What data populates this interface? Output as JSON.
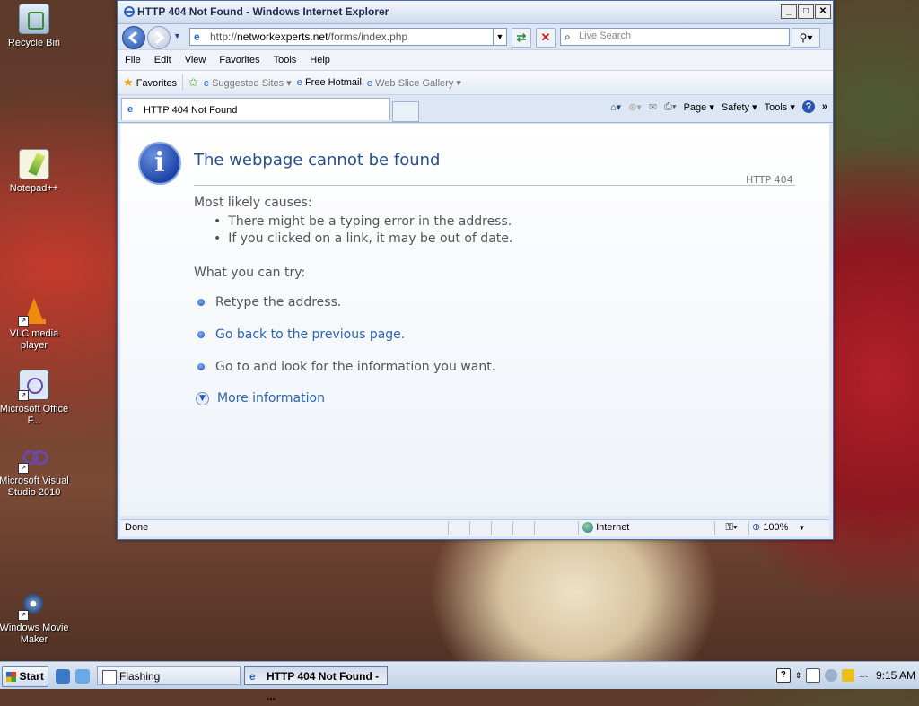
{
  "desktop": {
    "icons": [
      {
        "label": "Recycle Bin",
        "icon": "recycle-bin-icon"
      },
      {
        "label": "Notepad++",
        "icon": "notepadpp-icon"
      },
      {
        "label": "VLC media player",
        "icon": "vlc-icon"
      },
      {
        "label": "Microsoft Office F...",
        "icon": "office-icon"
      },
      {
        "label": "Microsoft Visual Studio 2010",
        "icon": "visual-studio-icon"
      },
      {
        "label": "Windows Movie Maker",
        "icon": "movie-maker-icon"
      }
    ]
  },
  "window": {
    "title": "HTTP 404 Not Found - Windows Internet Explorer",
    "controls": {
      "minimize": "_",
      "maximize": "□",
      "close": "✕"
    }
  },
  "address": {
    "url_prefix": "http://",
    "url_host": "networkexperts.net",
    "url_path": "/forms/index.php",
    "search_placeholder": "Live Search"
  },
  "menu": [
    "File",
    "Edit",
    "View",
    "Favorites",
    "Tools",
    "Help"
  ],
  "favorites_bar": {
    "favorites_label": "Favorites",
    "suggested_sites": "Suggested Sites",
    "free_hotmail": "Free Hotmail",
    "web_slice_gallery": "Web Slice Gallery"
  },
  "tab": {
    "title": "HTTP 404 Not Found"
  },
  "command_bar": {
    "page": "Page",
    "safety": "Safety",
    "tools": "Tools"
  },
  "error_page": {
    "title": "The webpage cannot be found",
    "code": "HTTP 404",
    "causes_heading": "Most likely causes:",
    "causes": [
      "There might be a typing error in the address.",
      "If you clicked on a link, it may be out of date."
    ],
    "try_heading": "What you can try:",
    "try_items": [
      {
        "text": "Retype the address.",
        "link": false
      },
      {
        "text": "Go back to the previous page.",
        "link": true
      },
      {
        "text": "Go to  and look for the information you want.",
        "link": false
      }
    ],
    "more_info": "More information"
  },
  "status": {
    "text": "Done",
    "zone": "Internet",
    "zoom": "100%"
  },
  "taskbar": {
    "start": "Start",
    "tasks": [
      {
        "label": "Flashing",
        "active": false
      },
      {
        "label": "HTTP 404 Not Found - ...",
        "active": true
      }
    ],
    "clock": "9:15 AM"
  }
}
